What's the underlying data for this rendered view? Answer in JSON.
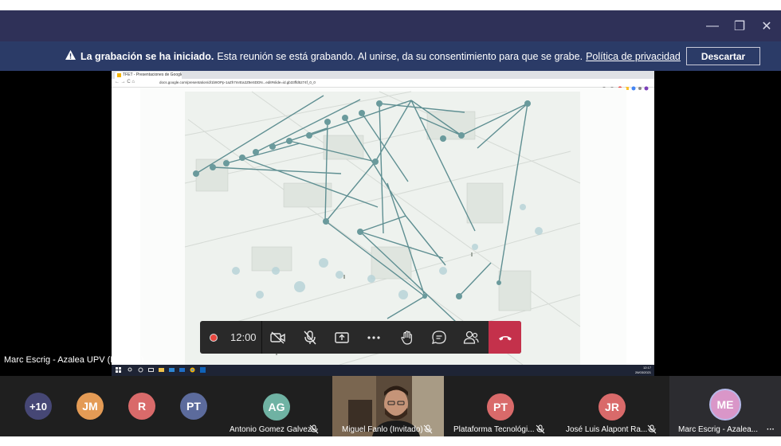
{
  "window": {
    "minimize": "—",
    "restore": "❐",
    "close": "✕"
  },
  "banner": {
    "title": "La grabación se ha iniciado.",
    "message": "Esta reunión se está grabando. Al unirse, da su consentimiento para que se grabe.",
    "link": "Política de privacidad",
    "dismiss": "Descartar"
  },
  "shared_screen": {
    "tab_title": "TFET - Presentaciones de Google",
    "address": "docs.google.com/presentation/d/1b9OPp-1aZh7mrEa2Z8eSDDN...edit#slide=id.gb33ffd5274f_0_0",
    "clock_time": "12:17",
    "clock_date": "26/03/2021"
  },
  "presenter_label": "Marc Escrig - Azalea UPV (Invitado)",
  "controls": {
    "timer": "12:00",
    "colors": {
      "hangup": "#c4314b",
      "rec": "#e8473f"
    }
  },
  "gallery": {
    "overflow": "+10",
    "avatars": [
      {
        "initials": "JM",
        "color": "#e49b55"
      },
      {
        "initials": "R",
        "color": "#d96a6a"
      },
      {
        "initials": "PT",
        "color": "#5c6b9c"
      }
    ],
    "tiles": [
      {
        "initials": "AG",
        "name": "Antonio Gomez Galvez",
        "color": "#6fb2a3"
      },
      {
        "initials": "",
        "name": "Miguel Fanlo (Invitado)",
        "color": ""
      },
      {
        "initials": "PT",
        "name": "Plataforma Tecnológi...",
        "color": "#d96a6a"
      },
      {
        "initials": "JR",
        "name": "José Luis Alapont Ra...",
        "color": "#d96a6a"
      },
      {
        "initials": "ME",
        "name": "Marc Escrig - Azalea...",
        "color": "#d996c8"
      }
    ],
    "more": "···"
  }
}
